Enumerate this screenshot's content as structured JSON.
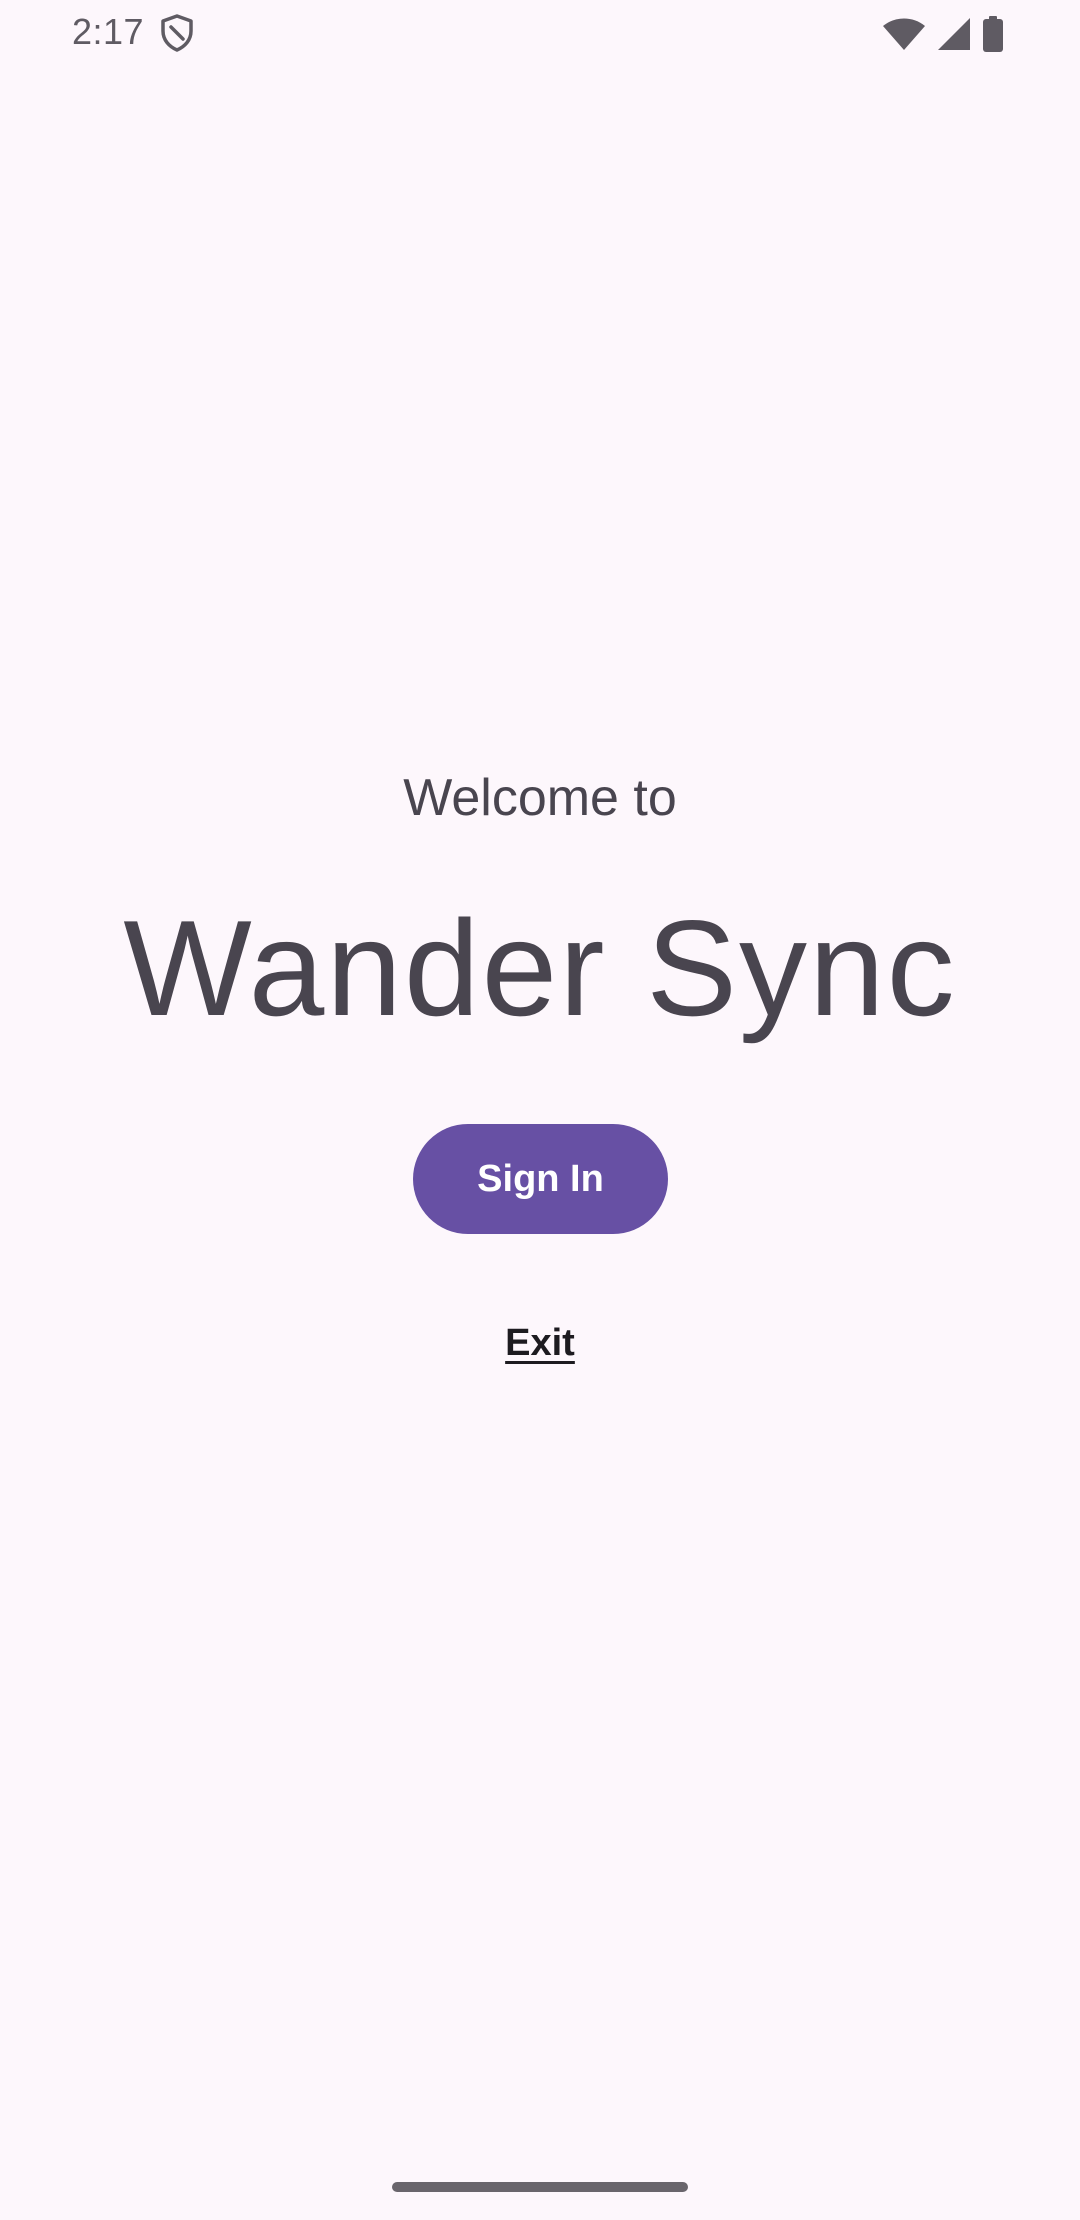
{
  "status_bar": {
    "time": "2:17",
    "icons": [
      "shield-icon",
      "wifi-icon",
      "cellular-signal-icon",
      "battery-icon"
    ],
    "icon_color": "#5f5b63"
  },
  "welcome": {
    "subtitle": "Welcome to",
    "title": "Wander Sync"
  },
  "actions": {
    "sign_in_label": "Sign In",
    "exit_label": "Exit"
  },
  "colors": {
    "background": "#fdf7fc",
    "primary": "#6750a4",
    "on_primary": "#ffffff",
    "text": "#49454f"
  }
}
